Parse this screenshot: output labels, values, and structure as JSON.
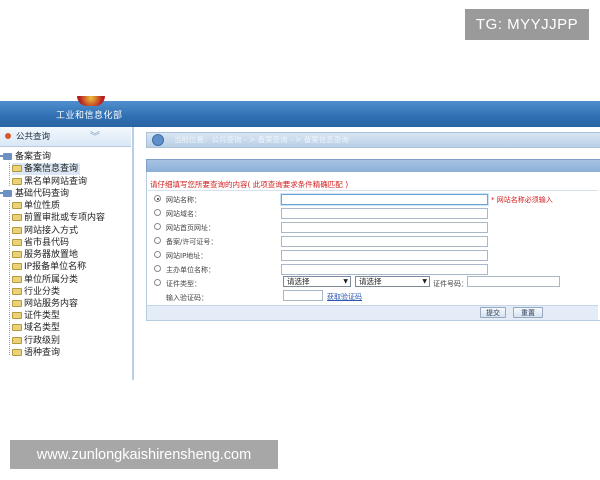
{
  "overlays": {
    "badge": "TG: MYYJJPP",
    "url": "www.zunlongkaishirensheng.com"
  },
  "header": {
    "site_title": "工业和信息化部"
  },
  "sidebar": {
    "title": "公共查询",
    "groups": [
      {
        "label": "备案查询",
        "items": [
          "备案信息查询",
          "黑名单网站查询"
        ]
      },
      {
        "label": "基础代码查询",
        "items": [
          "单位性质",
          "前置审批或专项内容",
          "网站接入方式",
          "省市县代码",
          "服务器放置地",
          "IP报备单位名称",
          "单位所属分类",
          "行业分类",
          "网站服务内容",
          "证件类型",
          "域名类型",
          "行政级别",
          "语种查询"
        ]
      }
    ]
  },
  "breadcrumb": {
    "text": "当前位置：公共查询  - > 备案查询  - > 备案信息查询"
  },
  "form": {
    "notice": "请仔细填写您所要查询的内容( 此项查询要求条件精确匹配 )",
    "fields": [
      {
        "label": "网站名称：",
        "value": "",
        "hint": "* 网站名称必须输入",
        "selected": true
      },
      {
        "label": "网站域名：",
        "value": ""
      },
      {
        "label": "网站首页网址：",
        "value": ""
      },
      {
        "label": "备案/许可证号：",
        "value": ""
      },
      {
        "label": "网站IP地址：",
        "value": ""
      },
      {
        "label": "主办单位名称：",
        "value": ""
      }
    ],
    "cert": {
      "label": "证件类型：",
      "select1": "请选择",
      "select2": "请选择",
      "number_label": "证件号码：",
      "number_value": ""
    },
    "captcha": {
      "label": "输入验证码：",
      "value": "",
      "link": "获取验证码"
    },
    "submit_label": "提交",
    "reset_label": "重置"
  }
}
